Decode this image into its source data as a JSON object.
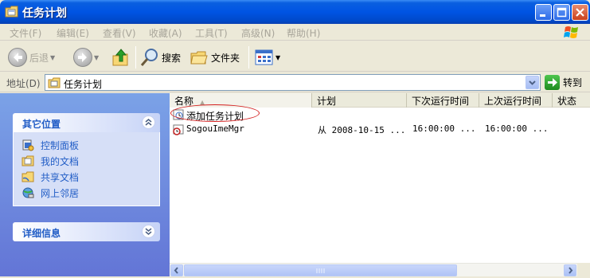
{
  "window": {
    "title": "任务计划",
    "minimize_label": "",
    "maximize_label": "",
    "close_label": ""
  },
  "menu": {
    "items": [
      "文件(F)",
      "编辑(E)",
      "查看(V)",
      "收藏(A)",
      "工具(T)",
      "高级(N)",
      "帮助(H)"
    ]
  },
  "toolbar": {
    "back_label": "后退",
    "search_label": "搜索",
    "folders_label": "文件夹"
  },
  "address": {
    "label": "地址(D)",
    "value": "任务计划",
    "go_label": "转到"
  },
  "left_pane": {
    "other_places": {
      "title": "其它位置",
      "links": [
        "控制面板",
        "我的文档",
        "共享文档",
        "网上邻居"
      ]
    },
    "details": {
      "title": "详细信息"
    }
  },
  "list": {
    "columns": [
      "名称",
      "计划",
      "下次运行时间",
      "上次运行时间",
      "状态"
    ],
    "rows": [
      {
        "name": "添加任务计划",
        "schedule": "",
        "next_run": "",
        "last_run": "",
        "status": ""
      },
      {
        "name": "SogouImeMgr",
        "schedule": "从 2008-10-15 ...",
        "next_run": "16:00:00  ...",
        "last_run": "16:00:00  ...",
        "status": ""
      }
    ]
  },
  "colors": {
    "title_blue": "#0054e3",
    "link_blue": "#215dc6",
    "highlight_red": "#d42020"
  }
}
